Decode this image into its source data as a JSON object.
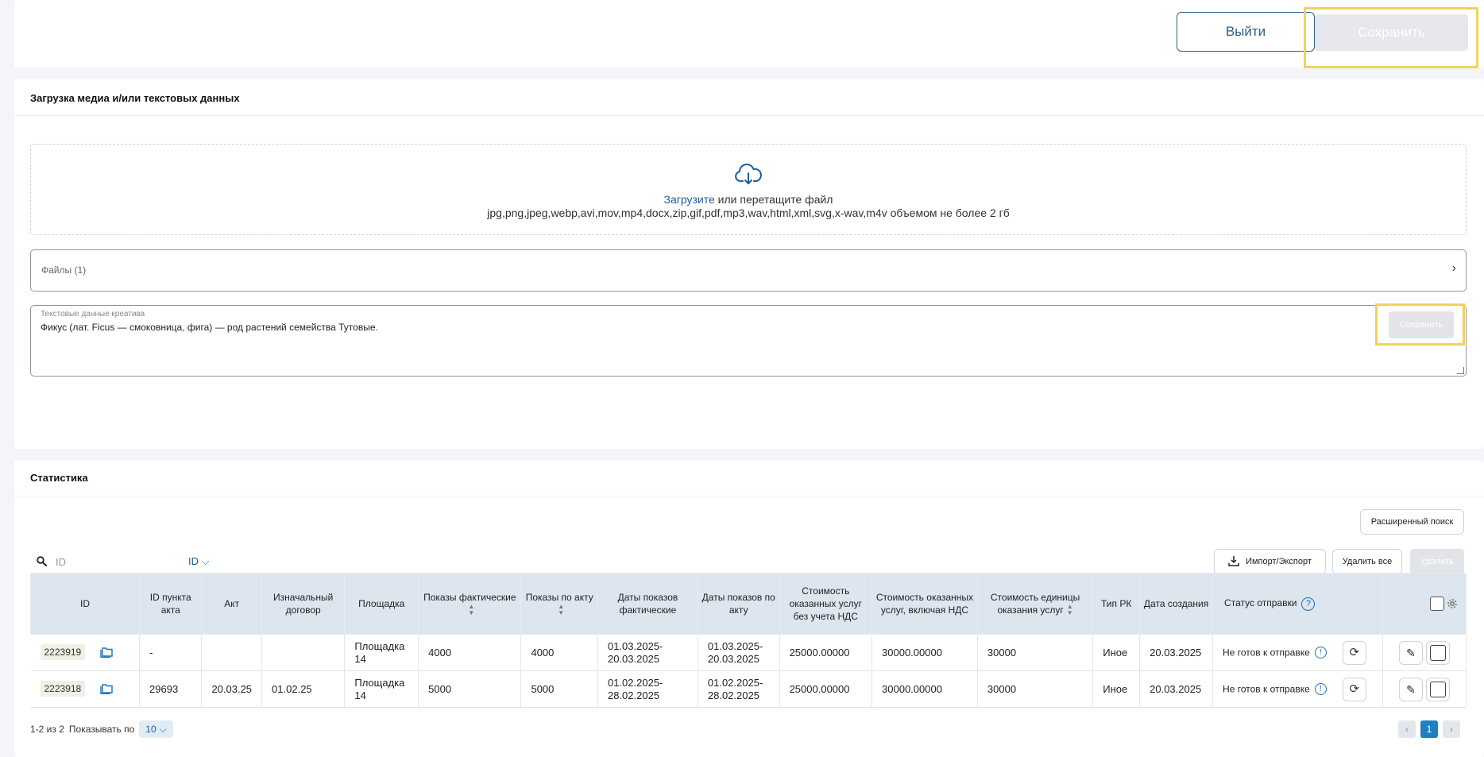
{
  "header": {
    "exit_label": "Выйти",
    "save_label": "Сохранить"
  },
  "upload": {
    "title": "Загрузка медиа и/или текстовых данных",
    "drop_link": "Загрузите",
    "drop_text": " или перетащите файл",
    "formats": "jpg,png,jpeg,webp,avi,mov,mp4,docx,zip,gif,pdf,mp3,wav,html,xml,svg,x-wav,m4v объемом не более 2 гб",
    "files_label": "Файлы (1)",
    "text_label": "Текстовые данные креатива",
    "text_value": "Фикус (лат. Ficus — смоковница, фига) — род растений семейства Тутовые.",
    "save_label": "Сохранить"
  },
  "stats": {
    "title": "Статистика",
    "extended_search": "Расширенный поиск",
    "search_placeholder": "ID",
    "search_field": "ID",
    "import_export": "Импорт/Экспорт",
    "delete_all": "Удалить все",
    "delete": "Удалить",
    "columns": {
      "id": "ID",
      "act_item_id": "ID пункта акта",
      "act": "Акт",
      "contract": "Изначальный договор",
      "platform": "Площадка",
      "shows_actual": "Показы фактические",
      "shows_act": "Показы по акту",
      "dates_actual": "Даты показов фактические",
      "dates_act": "Даты показов по акту",
      "cost_no_vat": "Стоимость оказанных услуг без учета НДС",
      "cost_vat": "Стоимость оказанных услуг, включая НДС",
      "unit_cost": "Стоимость единицы оказания услуг",
      "rk_type": "Тип РК",
      "created": "Дата создания",
      "status": "Статус отправки"
    },
    "rows": [
      {
        "id": "2223919",
        "act_item_id": "-",
        "act": "",
        "contract": "",
        "platform": "Площадка 14",
        "shows_actual": "4000",
        "shows_act": "4000",
        "dates_actual": "01.03.2025-20.03.2025",
        "dates_act": "01.03.2025-20.03.2025",
        "cost_no_vat": "25000.00000",
        "cost_vat": "30000.00000",
        "unit_cost": "30000",
        "rk_type": "Иное",
        "created": "20.03.2025",
        "status": "Не готов к отправке"
      },
      {
        "id": "2223918",
        "act_item_id": "29693",
        "act": "20.03.25",
        "contract": "01.02.25",
        "platform": "Площадка 14",
        "shows_actual": "5000",
        "shows_act": "5000",
        "dates_actual": "01.02.2025-28.02.2025",
        "dates_act": "01.02.2025-28.02.2025",
        "cost_no_vat": "25000.00000",
        "cost_vat": "30000.00000",
        "unit_cost": "30000",
        "rk_type": "Иное",
        "created": "20.03.2025",
        "status": "Не готов к отправке"
      }
    ],
    "pagination": {
      "range": "1-2 из 2",
      "show_label": "Показывать по",
      "page_size": "10",
      "current_page": "1",
      "prev": "‹",
      "next": "›"
    }
  },
  "colors": {
    "accent": "#1f5c99",
    "header_bg": "#dde6ef",
    "highlight": "#f2d25c"
  }
}
